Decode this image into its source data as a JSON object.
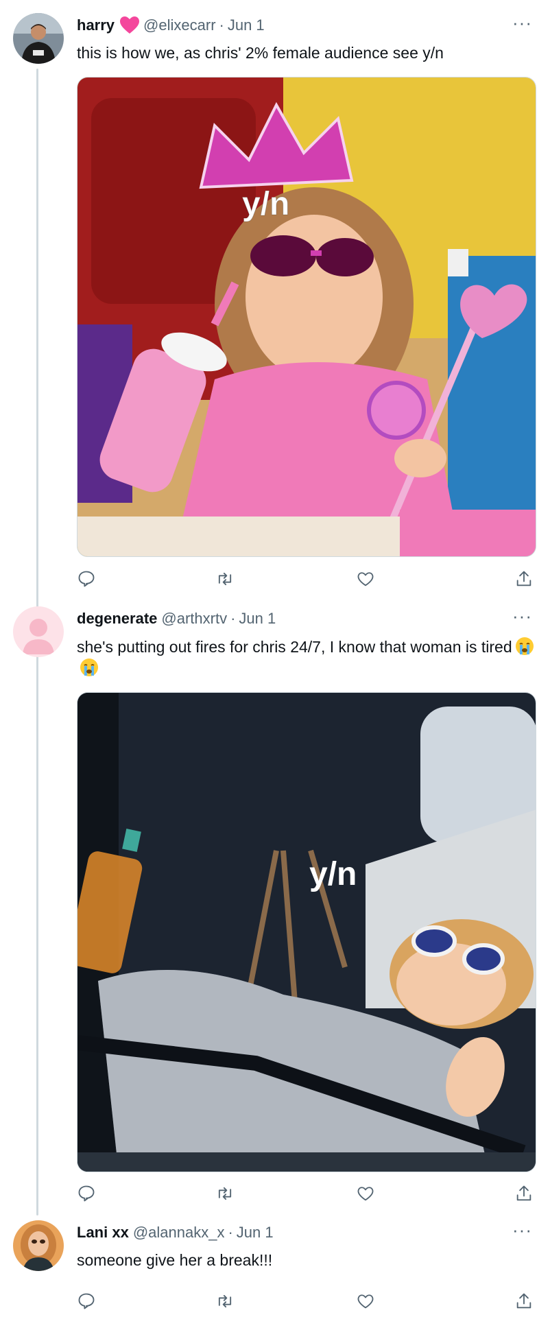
{
  "tweets": [
    {
      "name": "harry",
      "handle": "@elixecarr",
      "separator": "·",
      "date": "Jun 1",
      "text": "this is how we, as chris' 2% female audience see y/n",
      "media_caption": "y/n",
      "has_heart_emoji": true
    },
    {
      "name": "degenerate",
      "handle": "@arthxrtv",
      "separator": "·",
      "date": "Jun 1",
      "text": "she's putting out fires for chris 24/7, I know that woman is tired",
      "media_caption": "y/n"
    },
    {
      "name": "Lani xx",
      "handle": "@alannakx_x",
      "separator": "·",
      "date": "Jun 1",
      "text": "someone give her a break!!!"
    }
  ],
  "more_label": "···",
  "colors": {
    "secondary": "#536471",
    "thread_line": "#cfd9de",
    "heart": "#f4479c"
  },
  "icons": [
    "reply-icon",
    "retweet-icon",
    "like-icon",
    "share-icon",
    "more-icon"
  ]
}
